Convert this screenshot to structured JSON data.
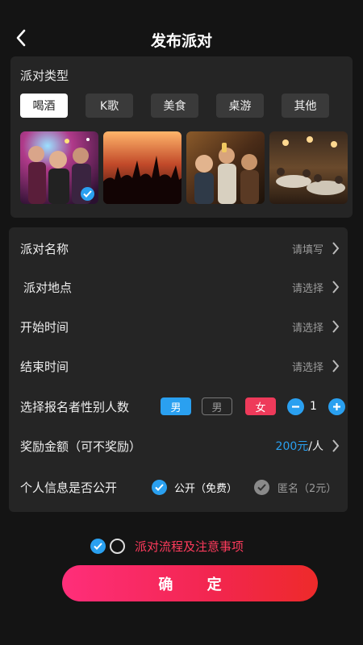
{
  "header": {
    "title": "发布派对"
  },
  "party_type": {
    "label": "派对类型",
    "options": [
      "喝酒",
      "K歌",
      "美食",
      "桌游",
      "其他"
    ],
    "selected": "喝酒"
  },
  "photos": [
    {
      "name": "photo-party-crowd",
      "selected": true
    },
    {
      "name": "photo-concert-silhouette",
      "selected": false
    },
    {
      "name": "photo-bar-cheers",
      "selected": false
    },
    {
      "name": "photo-restaurant-hall",
      "selected": false
    }
  ],
  "form": {
    "name": {
      "label": "派对名称",
      "value": "请填写"
    },
    "location": {
      "label": "派对地点",
      "value": "请选择"
    },
    "start": {
      "label": "开始时间",
      "value": "请选择"
    },
    "end": {
      "label": "结束时间",
      "value": "请选择"
    },
    "gender": {
      "label": "选择报名者性别人数",
      "male": "男",
      "male_alt": "男",
      "female": "女",
      "count": "1"
    },
    "reward": {
      "label": "奖励金额（可不奖励）",
      "amount": "200元",
      "unit": "/人"
    },
    "privacy": {
      "label": "个人信息是否公开",
      "public": "公开（免费）",
      "anonymous": "匿名（2元）"
    }
  },
  "agreement": {
    "text": "派对流程及注意事项"
  },
  "confirm": {
    "label": "确 定"
  },
  "colors": {
    "accent": "#2aa0f0",
    "danger": "#ee3a5a",
    "background": "#141414",
    "card": "#252525"
  }
}
